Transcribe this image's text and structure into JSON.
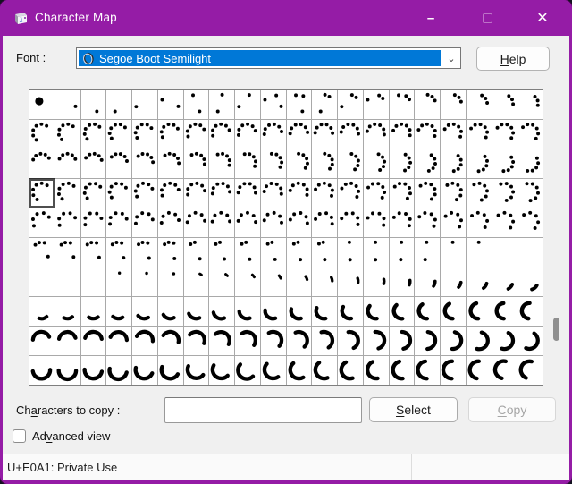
{
  "window": {
    "title": "Character Map",
    "accent_color": "#951CA6",
    "selection_blue": "#0078D7",
    "client_bg": "#F0F0F0"
  },
  "titlebar": {
    "app_icon": "character-map-cube-icon",
    "minimize_glyph": "–",
    "close_glyph": "✕"
  },
  "font_row": {
    "label": {
      "pre": "",
      "mn": "F",
      "post": "ont :"
    },
    "selected_font": "Segoe Boot Semilight",
    "font_type_icon": "opentype-icon",
    "dropdown_glyph": "⌄",
    "help": {
      "pre": "",
      "mn": "H",
      "post": "elp"
    }
  },
  "grid": {
    "columns": 20,
    "rows": 10,
    "selected_cell": {
      "row": 3,
      "col": 0
    },
    "glyph_color": "#000000",
    "row_glyphs": [
      {
        "type": "enter"
      },
      {
        "type": "dots",
        "lead": 36,
        "rate": 5,
        "spacing": 36,
        "count": 6
      },
      {
        "type": "dots",
        "lead": 60,
        "rate": 7,
        "spacing": 33,
        "count": 5
      },
      {
        "type": "dots",
        "lead": 40,
        "rate": 7,
        "spacing": 38,
        "count": 6
      },
      {
        "type": "dots",
        "lead": 60,
        "rate": 4.2,
        "spacing": 45,
        "count": 5
      },
      {
        "type": "exit"
      },
      {
        "type": "arc",
        "mid0": 8,
        "midRate": 8.3,
        "sw0": 7,
        "swRate": 2.3,
        "r": 9.5,
        "w0": 2.6,
        "wRate": 0.09,
        "emptyUntil": 3
      },
      {
        "type": "arc",
        "mid0": 168,
        "midRate": 5.6,
        "sw0": 60,
        "swRate": 6,
        "r": 8.8,
        "w0": 4.1,
        "wRate": 0.02,
        "emptyUntil": 0
      },
      {
        "type": "arc",
        "mid0": 350,
        "midRate": 6.8,
        "sw0": 152,
        "swRate": 1,
        "r": 9.6,
        "w0": 4.3,
        "wRate": 0,
        "emptyUntil": 0
      },
      {
        "type": "arc",
        "mid0": 175,
        "midRate": 6,
        "sw0": 172,
        "swRate": 0,
        "r": 9.8,
        "w0": 4.4,
        "wRate": 0,
        "emptyUntil": 0
      }
    ]
  },
  "copy_row": {
    "label": {
      "pre": "Ch",
      "mn": "a",
      "post": "racters to copy :"
    },
    "input_value": "",
    "select": {
      "pre": "",
      "mn": "S",
      "post": "elect"
    },
    "copy": {
      "pre": "",
      "mn": "C",
      "post": "opy"
    },
    "copy_enabled": false
  },
  "advanced_view": {
    "label": {
      "pre": "Ad",
      "mn": "v",
      "post": "anced view"
    },
    "checked": false
  },
  "status_bar": {
    "text": "U+E0A1: Private Use"
  }
}
